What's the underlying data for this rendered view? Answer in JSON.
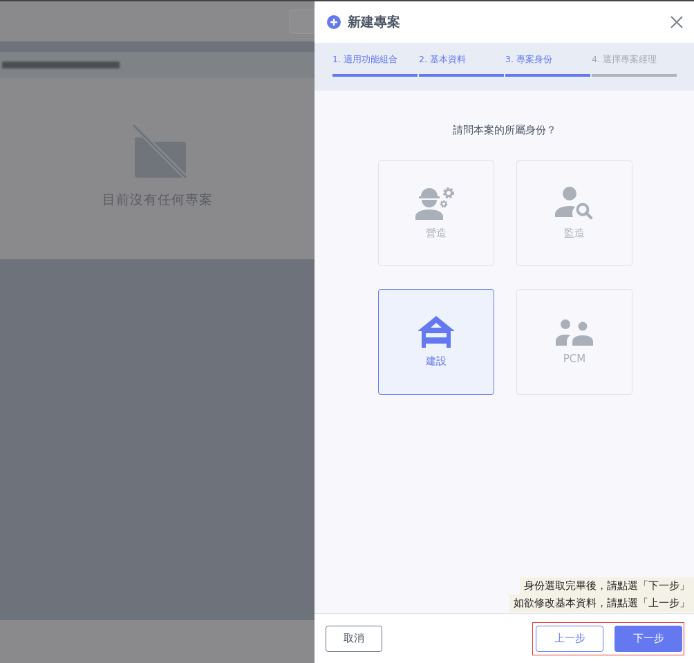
{
  "background": {
    "empty_message": "目前沒有任何專案"
  },
  "drawer": {
    "title": "新建專案",
    "steps": [
      {
        "label": "1. 適用功能組合",
        "active": true
      },
      {
        "label": "2. 基本資料",
        "active": true
      },
      {
        "label": "3. 專案身份",
        "active": true
      },
      {
        "label": "4. 選擇專案經理",
        "active": false
      }
    ],
    "question": "請問本案的所屬身份？",
    "roles": [
      {
        "kind": "contractor",
        "label": "營造",
        "selected": false
      },
      {
        "kind": "supervisor",
        "label": "監造",
        "selected": false
      },
      {
        "kind": "owner",
        "label": "建設",
        "selected": true
      },
      {
        "kind": "pcm",
        "label": "PCM",
        "selected": false
      }
    ],
    "hints": [
      "身份選取完畢後，請點選「下一步」",
      "如欲修改基本資料，請點選「上一步」"
    ],
    "buttons": {
      "cancel": "取消",
      "prev": "上一步",
      "next": "下一步"
    }
  }
}
